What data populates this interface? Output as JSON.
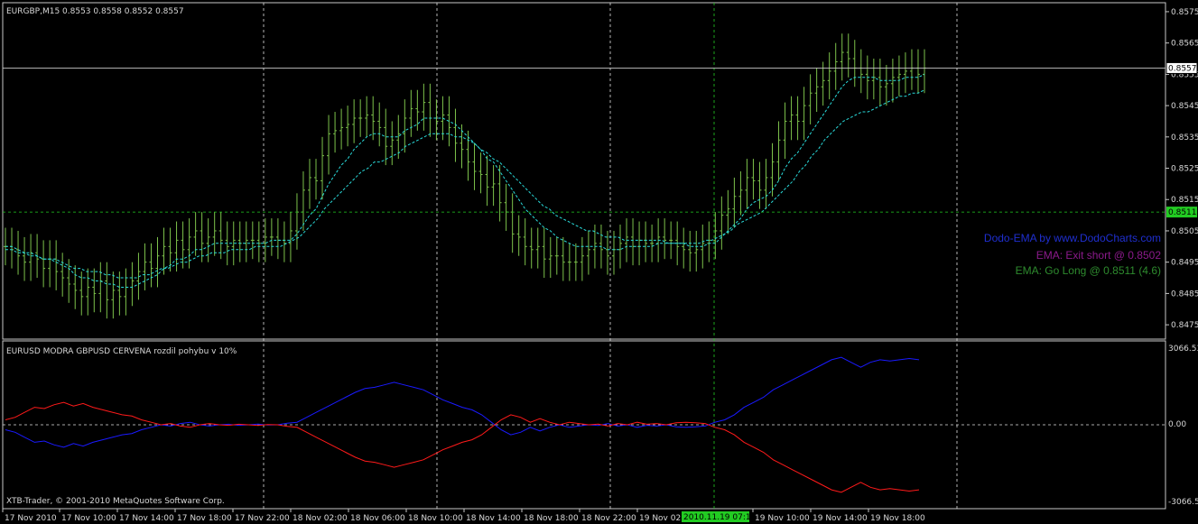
{
  "chart_data": [
    {
      "type": "bar",
      "title": "EURGBP,M15  0.8553 0.8558 0.8552 0.8557",
      "y_ticks": [
        "0.8575",
        "0.8565",
        "0.8555",
        "0.8545",
        "0.8535",
        "0.8525",
        "0.8515",
        "0.8505",
        "0.8495",
        "0.8485",
        "0.8475"
      ],
      "ylim": [
        0.8471,
        0.8577
      ],
      "current_price_label": "0.8557",
      "current_price": 0.8557,
      "long_level_label": "0.8511",
      "long_level": 0.8511,
      "bar_color": "#7dc24b",
      "ema_color": "#29d9d9",
      "closes": [
        0.85,
        0.8499,
        0.8497,
        0.8495,
        0.8498,
        0.8496,
        0.8493,
        0.8496,
        0.8492,
        0.849,
        0.8488,
        0.8486,
        0.8484,
        0.8487,
        0.8485,
        0.8489,
        0.8483,
        0.8486,
        0.8484,
        0.8487,
        0.8489,
        0.8492,
        0.8495,
        0.8493,
        0.8497,
        0.85,
        0.8498,
        0.8502,
        0.8499,
        0.8503,
        0.8505,
        0.8501,
        0.8503,
        0.8505,
        0.8502,
        0.85,
        0.8502,
        0.8501,
        0.8502,
        0.8502,
        0.8501,
        0.8503,
        0.8503,
        0.8502,
        0.8501,
        0.8505,
        0.8511,
        0.8518,
        0.8522,
        0.8521,
        0.8529,
        0.8536,
        0.8537,
        0.8538,
        0.8539,
        0.8541,
        0.8541,
        0.8542,
        0.854,
        0.8538,
        0.8532,
        0.8534,
        0.8536,
        0.8541,
        0.8544,
        0.8543,
        0.8546,
        0.8541,
        0.854,
        0.8542,
        0.8538,
        0.8533,
        0.8531,
        0.8527,
        0.8524,
        0.8523,
        0.8519,
        0.852,
        0.8514,
        0.8511,
        0.8504,
        0.8503,
        0.85,
        0.8499,
        0.85,
        0.8496,
        0.8497,
        0.8497,
        0.8495,
        0.8495,
        0.8495,
        0.8497,
        0.8499,
        0.8501,
        0.8499,
        0.8497,
        0.8499,
        0.8501,
        0.8503,
        0.85,
        0.8502,
        0.8501,
        0.8501,
        0.8503,
        0.8502,
        0.8502,
        0.85,
        0.8499,
        0.8498,
        0.8499,
        0.8501,
        0.8502,
        0.8505,
        0.851,
        0.8512,
        0.8516,
        0.8518,
        0.8522,
        0.8521,
        0.8518,
        0.8522,
        0.8527,
        0.8534,
        0.854,
        0.8542,
        0.854,
        0.8545,
        0.8549,
        0.8551,
        0.8553,
        0.8556,
        0.8559,
        0.8562,
        0.856,
        0.8557,
        0.8555,
        0.8553,
        0.8554,
        0.8551,
        0.8552,
        0.8554,
        0.8555,
        0.8556,
        0.8557,
        0.8555,
        0.8557
      ],
      "ema_fast": [
        0.85,
        0.85,
        0.8499,
        0.8498,
        0.8498,
        0.8497,
        0.8496,
        0.8496,
        0.8495,
        0.8494,
        0.8493,
        0.8491,
        0.849,
        0.849,
        0.8489,
        0.8489,
        0.8488,
        0.8488,
        0.8487,
        0.8487,
        0.8487,
        0.8488,
        0.8489,
        0.849,
        0.8491,
        0.8493,
        0.8494,
        0.8496,
        0.8496,
        0.8497,
        0.8499,
        0.8499,
        0.85,
        0.8501,
        0.8501,
        0.8501,
        0.8501,
        0.8501,
        0.8501,
        0.8501,
        0.8501,
        0.8501,
        0.8502,
        0.8502,
        0.8502,
        0.8502,
        0.8504,
        0.8507,
        0.851,
        0.8512,
        0.8516,
        0.852,
        0.8523,
        0.8526,
        0.8528,
        0.8531,
        0.8533,
        0.8535,
        0.8536,
        0.8536,
        0.8535,
        0.8535,
        0.8535,
        0.8537,
        0.8538,
        0.8539,
        0.8541,
        0.8541,
        0.8541,
        0.8541,
        0.854,
        0.8539,
        0.8537,
        0.8535,
        0.8533,
        0.8531,
        0.8528,
        0.8527,
        0.8524,
        0.8521,
        0.8518,
        0.8515,
        0.8512,
        0.851,
        0.8508,
        0.8506,
        0.8505,
        0.8503,
        0.8502,
        0.8501,
        0.85,
        0.85,
        0.85,
        0.85,
        0.85,
        0.8499,
        0.8499,
        0.8499,
        0.85,
        0.85,
        0.85,
        0.85,
        0.85,
        0.8501,
        0.8501,
        0.8501,
        0.8501,
        0.8501,
        0.85,
        0.85,
        0.85,
        0.8501,
        0.8501,
        0.8503,
        0.8505,
        0.8507,
        0.8509,
        0.8512,
        0.8514,
        0.8515,
        0.8516,
        0.8518,
        0.8521,
        0.8525,
        0.8528,
        0.853,
        0.8533,
        0.8536,
        0.8539,
        0.8542,
        0.8545,
        0.8548,
        0.8551,
        0.8553,
        0.8554,
        0.8554,
        0.8554,
        0.8554,
        0.8553,
        0.8553,
        0.8553,
        0.8553,
        0.8554,
        0.8554,
        0.8554,
        0.8555
      ],
      "ema_slow": [
        0.8499,
        0.8499,
        0.8498,
        0.8498,
        0.8497,
        0.8497,
        0.8496,
        0.8496,
        0.8496,
        0.8495,
        0.8494,
        0.8493,
        0.8493,
        0.8492,
        0.8492,
        0.8492,
        0.8491,
        0.8491,
        0.849,
        0.849,
        0.849,
        0.849,
        0.8491,
        0.8491,
        0.8492,
        0.8493,
        0.8493,
        0.8494,
        0.8495,
        0.8495,
        0.8496,
        0.8497,
        0.8497,
        0.8498,
        0.8498,
        0.8498,
        0.8499,
        0.8499,
        0.8499,
        0.8499,
        0.85,
        0.85,
        0.85,
        0.85,
        0.85,
        0.8501,
        0.8502,
        0.8503,
        0.8505,
        0.8507,
        0.8509,
        0.8512,
        0.8514,
        0.8516,
        0.8518,
        0.852,
        0.8522,
        0.8524,
        0.8525,
        0.8527,
        0.8527,
        0.8528,
        0.8529,
        0.853,
        0.8532,
        0.8533,
        0.8534,
        0.8535,
        0.8536,
        0.8536,
        0.8536,
        0.8536,
        0.8535,
        0.8535,
        0.8534,
        0.8533,
        0.8531,
        0.853,
        0.8528,
        0.8527,
        0.8525,
        0.8523,
        0.8521,
        0.8519,
        0.8517,
        0.8515,
        0.8513,
        0.8512,
        0.851,
        0.8509,
        0.8508,
        0.8507,
        0.8506,
        0.8505,
        0.8505,
        0.8504,
        0.8503,
        0.8503,
        0.8503,
        0.8502,
        0.8502,
        0.8502,
        0.8502,
        0.8502,
        0.8502,
        0.8502,
        0.8501,
        0.8501,
        0.8501,
        0.8501,
        0.8501,
        0.8501,
        0.8502,
        0.8502,
        0.8503,
        0.8504,
        0.8505,
        0.8507,
        0.8508,
        0.8509,
        0.851,
        0.8511,
        0.8513,
        0.8515,
        0.8517,
        0.8519,
        0.8521,
        0.8524,
        0.8526,
        0.8529,
        0.8531,
        0.8534,
        0.8536,
        0.8538,
        0.854,
        0.8541,
        0.8542,
        0.8543,
        0.8543,
        0.8544,
        0.8545,
        0.8546,
        0.8547,
        0.8548,
        0.8548,
        0.8549,
        0.8549,
        0.855
      ]
    },
    {
      "type": "line",
      "title": "EURUSD MODRA   GBPUSD CERVENA     rozdil pohybu v 10%",
      "y_top_label": "3066.53",
      "y_bottom_label": "-3066.53",
      "y_zero_label": "0.00",
      "ylim": [
        -3066.53,
        3066.53
      ],
      "series": [
        {
          "name": "EURUSD MODRA",
          "color": "#1a1aff",
          "values": [
            -200,
            -300,
            -500,
            -700,
            -650,
            -800,
            -900,
            -750,
            -850,
            -700,
            -600,
            -500,
            -400,
            -350,
            -200,
            -100,
            0,
            -50,
            50,
            100,
            0,
            -50,
            0,
            20,
            -20,
            0,
            30,
            -10,
            0,
            60,
            100,
            300,
            500,
            700,
            900,
            1100,
            1300,
            1450,
            1500,
            1600,
            1700,
            1600,
            1500,
            1400,
            1200,
            1000,
            850,
            700,
            600,
            400,
            100,
            -200,
            -400,
            -300,
            -100,
            -250,
            -100,
            0,
            -100,
            -50,
            0,
            -30,
            50,
            -50,
            0,
            -100,
            -20,
            -50,
            0,
            -80,
            -100,
            -80,
            -50,
            100,
            200,
            400,
            700,
            900,
            1100,
            1400,
            1600,
            1800,
            2000,
            2200,
            2400,
            2600,
            2700,
            2500,
            2300,
            2500,
            2600,
            2550,
            2600,
            2650,
            2600
          ]
        },
        {
          "name": "GBPUSD CERVENA",
          "color": "#ff1a1a",
          "values": [
            200,
            300,
            500,
            700,
            650,
            800,
            900,
            750,
            850,
            700,
            600,
            500,
            400,
            350,
            200,
            100,
            0,
            50,
            -50,
            -100,
            0,
            50,
            0,
            -20,
            20,
            0,
            -30,
            10,
            0,
            -60,
            -100,
            -300,
            -500,
            -700,
            -900,
            -1100,
            -1300,
            -1450,
            -1500,
            -1600,
            -1700,
            -1600,
            -1500,
            -1400,
            -1200,
            -1000,
            -850,
            -700,
            -600,
            -400,
            -100,
            200,
            400,
            300,
            100,
            250,
            100,
            0,
            100,
            50,
            0,
            30,
            -50,
            50,
            0,
            100,
            20,
            50,
            0,
            80,
            100,
            80,
            50,
            -100,
            -200,
            -400,
            -700,
            -900,
            -1100,
            -1400,
            -1600,
            -1800,
            -2000,
            -2200,
            -2400,
            -2600,
            -2700,
            -2500,
            -2300,
            -2500,
            -2600,
            -2550,
            -2600,
            -2650,
            -2600
          ]
        }
      ]
    }
  ],
  "indicator": {
    "credit": "Dodo-EMA by www.DodoCharts.com",
    "exit_short": "EMA: Exit short @ 0.8502",
    "go_long": "EMA: Go Long @ 0.8511 (4.6)",
    "credit_color": "#1f2fd0",
    "exit_color": "#8b1a8b",
    "long_color": "#2e8b2e"
  },
  "copyright": "XTB-Trader, © 2001-2010 MetaQuotes Software Corp.",
  "x_ticks": [
    "17 Nov 2010",
    "17 Nov 10:00",
    "17 Nov 14:00",
    "17 Nov 18:00",
    "17 Nov 22:00",
    "18 Nov 02:00",
    "18 Nov 06:00",
    "18 Nov 10:00",
    "18 Nov 14:00",
    "18 Nov 18:00",
    "18 Nov 22:00",
    "19 Nov 02",
    "2010.11.19 07:15",
    "19 Nov 10:00",
    "19 Nov 14:00",
    "19 Nov 18:00"
  ],
  "cursor_time_label": "2010.11.19 07:15"
}
